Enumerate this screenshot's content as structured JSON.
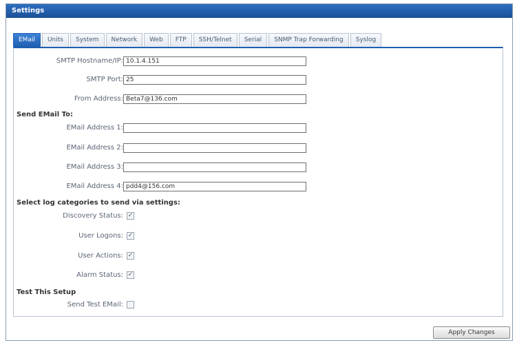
{
  "window": {
    "title": "Settings"
  },
  "tabs": [
    "EMail",
    "Units",
    "System",
    "Network",
    "Web",
    "FTP",
    "SSH/Telnet",
    "Serial",
    "SNMP Trap Forwarding",
    "Syslog"
  ],
  "smtp": {
    "hostname_label": "SMTP Hostname/IP:",
    "hostname_value": "10.1.4.151",
    "port_label": "SMTP Port:",
    "port_value": "25",
    "from_label": "From Address:",
    "from_value": "Beta7@136.com"
  },
  "send_to": {
    "heading": "Send EMail To:",
    "addresses": [
      {
        "label": "EMail Address 1:",
        "value": ""
      },
      {
        "label": "EMail Address 2:",
        "value": ""
      },
      {
        "label": "EMail Address 3:",
        "value": ""
      },
      {
        "label": "EMail Address 4:",
        "value": "pdd4@156.com"
      }
    ]
  },
  "log_categories": {
    "heading": "Select log categories to send via settings:",
    "items": [
      {
        "label": "Discovery Status:",
        "checked": true
      },
      {
        "label": "User Logons:",
        "checked": true
      },
      {
        "label": "User Actions:",
        "checked": true
      },
      {
        "label": "Alarm Status:",
        "checked": true
      }
    ]
  },
  "test": {
    "heading": "Test This Setup",
    "send_label": "Send Test EMail:",
    "checked": false
  },
  "apply_label": "Apply Changes"
}
